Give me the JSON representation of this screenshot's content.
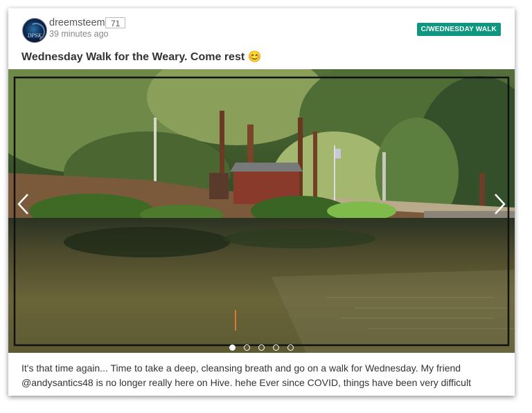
{
  "post": {
    "author": "dreemsteem",
    "reputation": "71",
    "time": "39 minutes ago",
    "community": "C/WEDNESDAY WALK",
    "title": "Wednesday Walk for the Weary. Come rest 😊",
    "excerpt": "It's that time again... Time to take a deep, cleansing breath and go on a walk for Wednesday. My friend @andysantics48 is no longer really here on Hive. hehe Ever since COVID, things have been very difficult"
  },
  "slider": {
    "slide_count": 5,
    "active_index": 0,
    "image": "pond-with-pine-trees-and-cabin"
  },
  "icons": {
    "prev": "chevron-left-icon",
    "next": "chevron-right-icon"
  },
  "colors": {
    "community_badge": "#0e9780",
    "title_text": "#333333",
    "meta_text": "#888888"
  }
}
